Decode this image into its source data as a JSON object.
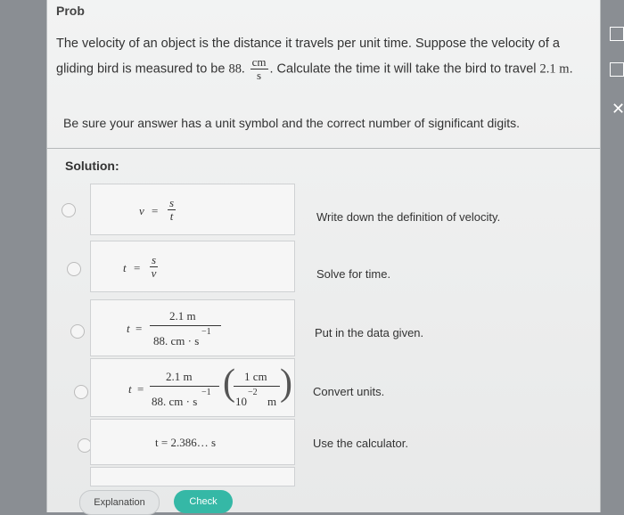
{
  "problem": {
    "title": "Prob",
    "text_pre": "The velocity of an object is the distance it travels per unit time. Suppose the velocity of a gliding bird is measured to be",
    "value": "88.",
    "unit_num": "cm",
    "unit_den": "s",
    "text_post": ". Calculate the time it will take the bird to travel",
    "distance": "2.1 m",
    "instructions": "Be sure your answer has a unit symbol and the correct number of significant digits."
  },
  "solution": {
    "label": "Solution:",
    "steps": [
      {
        "note": "Write down the definition of velocity."
      },
      {
        "note": "Solve for time."
      },
      {
        "note": "Put in the data given."
      },
      {
        "note": "Convert units."
      },
      {
        "note": "Use the calculator."
      }
    ],
    "eq": {
      "v": "v",
      "t": "t",
      "s": "s",
      "eq": "=",
      "dist": "2.1 m",
      "vel": "88. cm · s",
      "exp": "−1",
      "conv_num": "1 cm",
      "conv_den": "10",
      "conv_exp": "−2",
      "conv_unit": "m",
      "result": "t = 2.386… s"
    }
  },
  "buttons": {
    "explanation": "Explanation",
    "check": "Check"
  },
  "side": {
    "close": "✕"
  }
}
